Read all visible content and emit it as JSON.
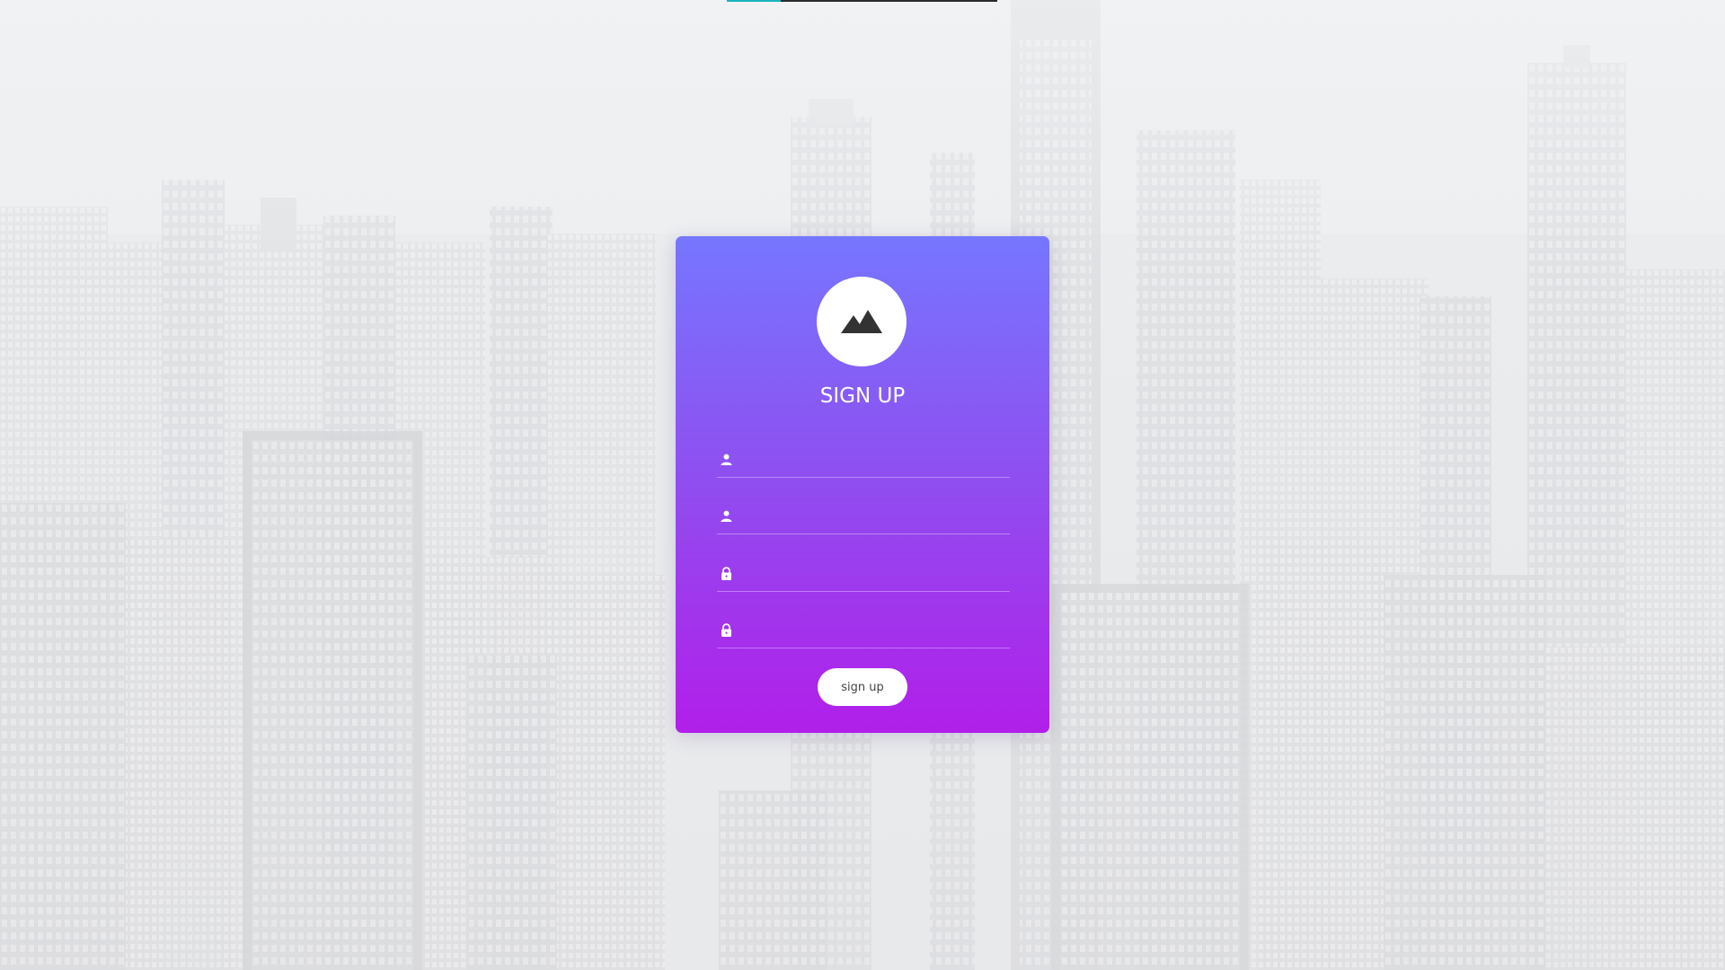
{
  "page": {
    "title": "SIGN UP"
  },
  "loader": {
    "progress_fraction": 0.2
  },
  "colors": {
    "card_gradient_top": "#7676ff",
    "card_gradient_bottom": "#b11fe9",
    "accent_bar": "#19b3bd",
    "button_bg": "#ffffff",
    "button_text": "#444444"
  },
  "logo": {
    "icon": "mountain-icon"
  },
  "form": {
    "fields": [
      {
        "icon": "user-icon",
        "value": "",
        "placeholder": ""
      },
      {
        "icon": "user-icon",
        "value": "",
        "placeholder": ""
      },
      {
        "icon": "lock-icon",
        "value": "",
        "placeholder": ""
      },
      {
        "icon": "lock-icon",
        "value": "",
        "placeholder": ""
      }
    ],
    "submit_label": "sign up"
  }
}
